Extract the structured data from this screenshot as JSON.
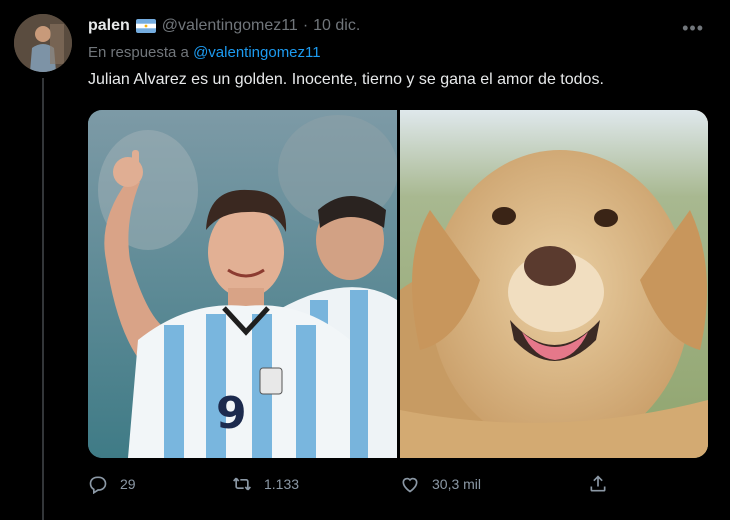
{
  "tweet": {
    "author_name": "palen",
    "flag": "argentina-flag",
    "handle": "@valentingomez11",
    "separator": "·",
    "date": "10 dic.",
    "more_label": "•••",
    "replying_prefix": "En respuesta a",
    "replying_handle": "@valentingomez11",
    "text": "Julian Alvarez es un golden. Inocente, tierno y se gana el amor de todos.",
    "media": [
      {
        "icon": "football-player-photo"
      },
      {
        "icon": "golden-retriever-photo"
      }
    ]
  },
  "actions": {
    "reply_count": "29",
    "retweet_count": "1.133",
    "like_count": "30,3 mil",
    "icons": [
      "reply-icon",
      "retweet-icon",
      "like-icon",
      "share-icon"
    ]
  },
  "colors": {
    "background": "#000000",
    "text": "#e7e9ea",
    "secondary": "#71767b",
    "link": "#1d9bf0"
  }
}
